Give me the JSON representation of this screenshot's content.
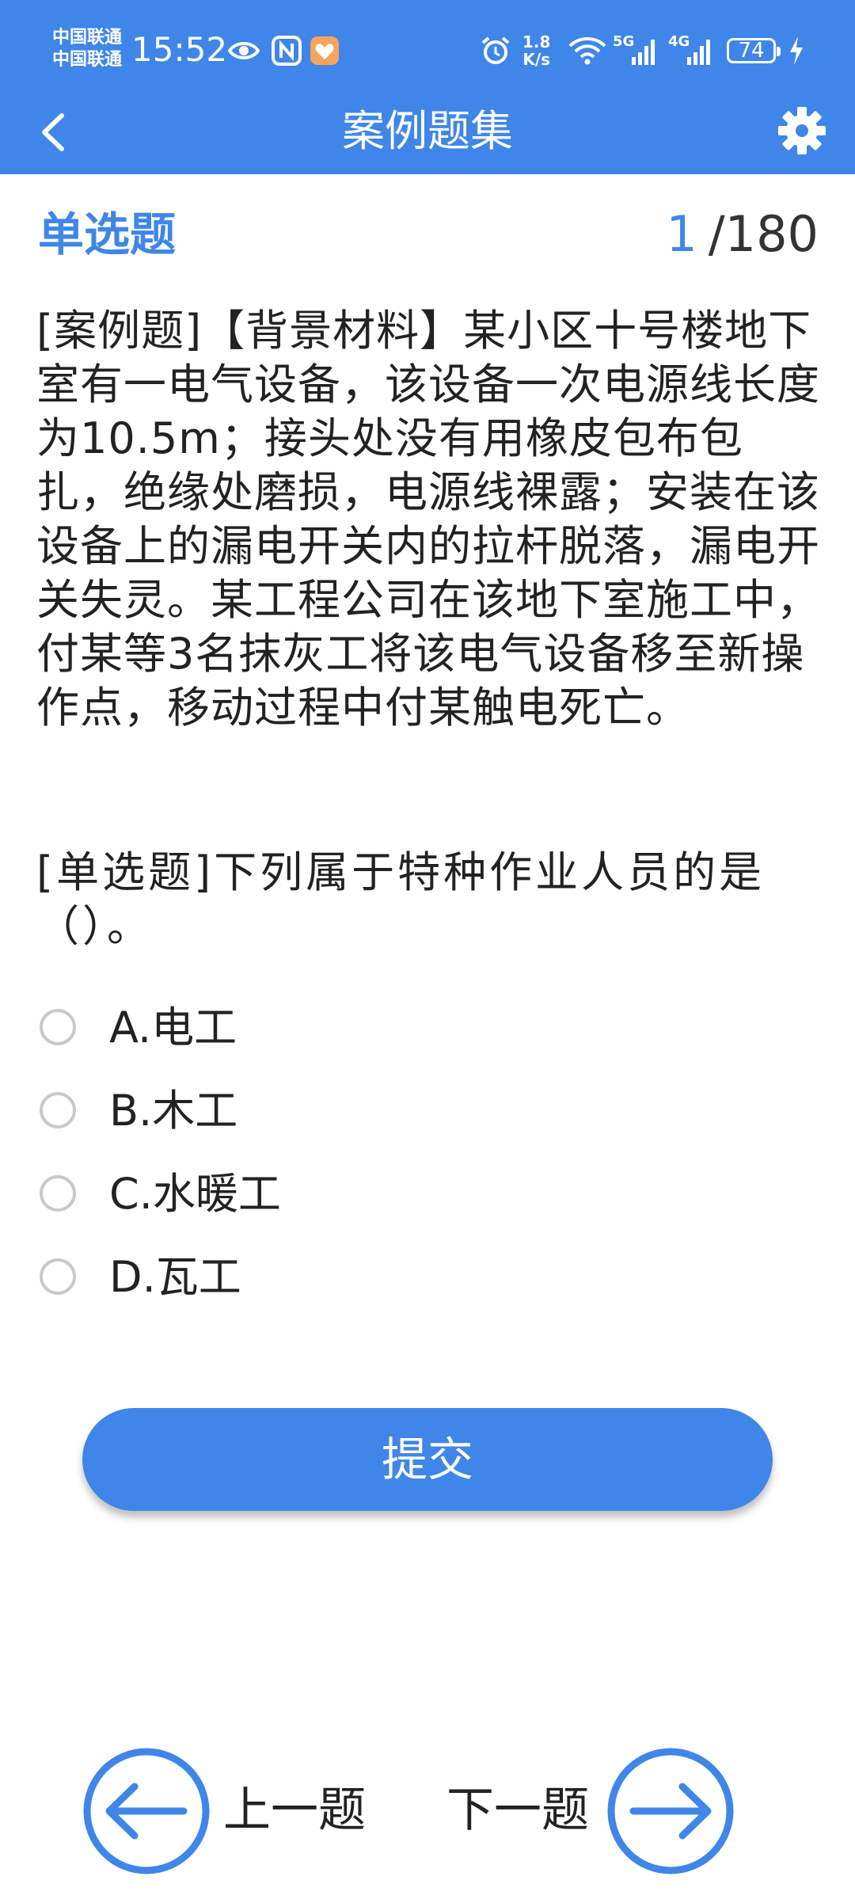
{
  "status_bar": {
    "carrier_1": "中国联通",
    "carrier_2": "中国联通",
    "time": "15:52",
    "net_speed_value": "1.8",
    "net_speed_unit": "K/s",
    "sig1_label": "5G",
    "sig2_label": "4G",
    "battery": "74",
    "icons": [
      "eye-icon",
      "nfc-icon",
      "heart-app-icon",
      "alarm-icon",
      "wifi-icon",
      "signal-icon",
      "signal-icon",
      "charging-icon"
    ]
  },
  "nav": {
    "title": "案例题集",
    "back_icon": "chevron-left-icon",
    "settings_icon": "gear-icon"
  },
  "question": {
    "type": "单选题",
    "current": "1",
    "total": "/180",
    "material": "[案例题]【背景材料】某小区十号楼地下室有一电气设备，该设备一次电源线长度为10.5m；接头处没有用橡皮包布包扎，绝缘处磨损，电源线裸露；安装在该设备上的漏电开关内的拉杆脱落，漏电开关失灵。某工程公司在该地下室施工中，付某等3名抹灰工将该电气设备移至新操作点，移动过程中付某触电死亡。",
    "stem": "[单选题]下列属于特种作业人员的是（）。",
    "options": [
      {
        "label": "A.电工",
        "checked": false
      },
      {
        "label": "B.木工",
        "checked": false
      },
      {
        "label": "C.水暖工",
        "checked": false
      },
      {
        "label": "D.瓦工",
        "checked": false
      }
    ]
  },
  "actions": {
    "submit": "提交",
    "prev": "上一题",
    "next": "下一题"
  },
  "colors": {
    "primary": "#3f86e8",
    "text": "#222222",
    "radio_border": "#c9c9c9"
  }
}
